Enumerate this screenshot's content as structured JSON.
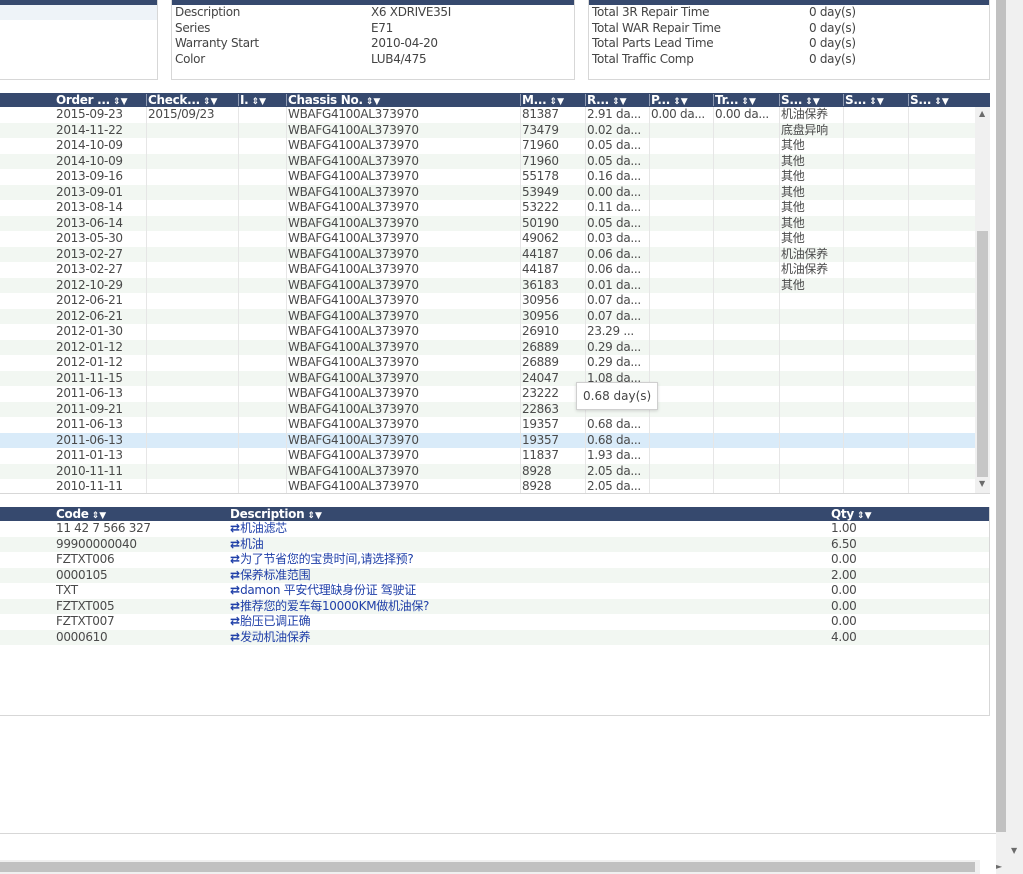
{
  "vehicle_info": {
    "rows": [
      {
        "label": "Description",
        "value": "X6 XDRIVE35I"
      },
      {
        "label": "Series",
        "value": "E71"
      },
      {
        "label": "Warranty Start",
        "value": "2010-04-20"
      },
      {
        "label": "Color",
        "value": "LUB4/475"
      }
    ]
  },
  "repair_summary": {
    "rows": [
      {
        "label": "Total 3R Repair Time",
        "value": "0 day(s)"
      },
      {
        "label": "Total WAR Repair Time",
        "value": "0 day(s)"
      },
      {
        "label": "Total Parts Lead Time",
        "value": "0 day(s)"
      },
      {
        "label": "Total Traffic Comp",
        "value": "0 day(s)"
      }
    ]
  },
  "orders_grid": {
    "headers": [
      "Order ...",
      "Check...",
      "I.",
      "Chassis No.",
      "M...",
      "R...",
      "P...",
      "Tr...",
      "S...",
      "S...",
      "S..."
    ],
    "icons": {
      "sort": "⇕",
      "filter": "▼"
    },
    "selected_index": 21,
    "tooltip": "0.68 day(s)",
    "rows": [
      [
        "2015-09-23",
        "2015/09/23",
        "",
        "WBAFG4100AL373970",
        "81387",
        "2.91 da...",
        "0.00 da...",
        "0.00 da...",
        "机油保养",
        "",
        ""
      ],
      [
        "2014-11-22",
        "",
        "",
        "WBAFG4100AL373970",
        "73479",
        "0.02 da...",
        "",
        "",
        "底盘异响",
        "",
        ""
      ],
      [
        "2014-10-09",
        "",
        "",
        "WBAFG4100AL373970",
        "71960",
        "0.05 da...",
        "",
        "",
        "其他",
        "",
        ""
      ],
      [
        "2014-10-09",
        "",
        "",
        "WBAFG4100AL373970",
        "71960",
        "0.05 da...",
        "",
        "",
        "其他",
        "",
        ""
      ],
      [
        "2013-09-16",
        "",
        "",
        "WBAFG4100AL373970",
        "55178",
        "0.16 da...",
        "",
        "",
        "其他",
        "",
        ""
      ],
      [
        "2013-09-01",
        "",
        "",
        "WBAFG4100AL373970",
        "53949",
        "0.00 da...",
        "",
        "",
        "其他",
        "",
        ""
      ],
      [
        "2013-08-14",
        "",
        "",
        "WBAFG4100AL373970",
        "53222",
        "0.11 da...",
        "",
        "",
        "其他",
        "",
        ""
      ],
      [
        "2013-06-14",
        "",
        "",
        "WBAFG4100AL373970",
        "50190",
        "0.05 da...",
        "",
        "",
        "其他",
        "",
        ""
      ],
      [
        "2013-05-30",
        "",
        "",
        "WBAFG4100AL373970",
        "49062",
        "0.03 da...",
        "",
        "",
        "其他",
        "",
        ""
      ],
      [
        "2013-02-27",
        "",
        "",
        "WBAFG4100AL373970",
        "44187",
        "0.06 da...",
        "",
        "",
        "机油保养",
        "",
        ""
      ],
      [
        "2013-02-27",
        "",
        "",
        "WBAFG4100AL373970",
        "44187",
        "0.06 da...",
        "",
        "",
        "机油保养",
        "",
        ""
      ],
      [
        "2012-10-29",
        "",
        "",
        "WBAFG4100AL373970",
        "36183",
        "0.01 da...",
        "",
        "",
        "其他",
        "",
        ""
      ],
      [
        "2012-06-21",
        "",
        "",
        "WBAFG4100AL373970",
        "30956",
        "0.07 da...",
        "",
        "",
        "",
        "",
        ""
      ],
      [
        "2012-06-21",
        "",
        "",
        "WBAFG4100AL373970",
        "30956",
        "0.07 da...",
        "",
        "",
        "",
        "",
        ""
      ],
      [
        "2012-01-30",
        "",
        "",
        "WBAFG4100AL373970",
        "26910",
        "23.29 ...",
        "",
        "",
        "",
        "",
        ""
      ],
      [
        "2012-01-12",
        "",
        "",
        "WBAFG4100AL373970",
        "26889",
        "0.29 da...",
        "",
        "",
        "",
        "",
        ""
      ],
      [
        "2012-01-12",
        "",
        "",
        "WBAFG4100AL373970",
        "26889",
        "0.29 da...",
        "",
        "",
        "",
        "",
        ""
      ],
      [
        "2011-11-15",
        "",
        "",
        "WBAFG4100AL373970",
        "24047",
        "1.08 da...",
        "",
        "",
        "",
        "",
        ""
      ],
      [
        "2011-06-13",
        "",
        "",
        "WBAFG4100AL373970",
        "23222",
        "",
        "",
        "",
        "",
        "",
        ""
      ],
      [
        "2011-09-21",
        "",
        "",
        "WBAFG4100AL373970",
        "22863",
        "",
        "",
        "",
        "",
        "",
        ""
      ],
      [
        "2011-06-13",
        "",
        "",
        "WBAFG4100AL373970",
        "19357",
        "0.68 da...",
        "",
        "",
        "",
        "",
        ""
      ],
      [
        "2011-06-13",
        "",
        "",
        "WBAFG4100AL373970",
        "19357",
        "0.68 da...",
        "",
        "",
        "",
        "",
        ""
      ],
      [
        "2011-01-13",
        "",
        "",
        "WBAFG4100AL373970",
        "11837",
        "1.93 da...",
        "",
        "",
        "",
        "",
        ""
      ],
      [
        "2010-11-11",
        "",
        "",
        "WBAFG4100AL373970",
        "8928",
        "2.05 da...",
        "",
        "",
        "",
        "",
        ""
      ],
      [
        "2010-11-11",
        "",
        "",
        "WBAFG4100AL373970",
        "8928",
        "2.05 da...",
        "",
        "",
        "",
        "",
        ""
      ]
    ]
  },
  "parts_grid": {
    "headers": [
      "Code",
      "Description",
      "Qty"
    ],
    "link_icon": "⇄",
    "rows": [
      [
        "11 42 7 566 327",
        "机油滤芯",
        "1.00"
      ],
      [
        "99900000040",
        "机油",
        "6.50"
      ],
      [
        "FZTXT006",
        "为了节省您的宝贵时间,请选择预?",
        "0.00"
      ],
      [
        "0000105",
        "保养标准范围",
        "2.00"
      ],
      [
        "TXT",
        "damon 平安代理缺身份证 驾驶证",
        "0.00"
      ],
      [
        "FZTXT005",
        "推荐您的爱车每10000KM做机油保?",
        "0.00"
      ],
      [
        "FZTXT007",
        "胎压已调正确",
        "0.00"
      ],
      [
        "0000610",
        "发动机油保养",
        "4.00"
      ]
    ]
  },
  "colors": {
    "header_bg": "#36496e",
    "row_alt": "#f2f7f2",
    "row_selected": "#d9ebf9",
    "link": "#1f3fa8"
  }
}
